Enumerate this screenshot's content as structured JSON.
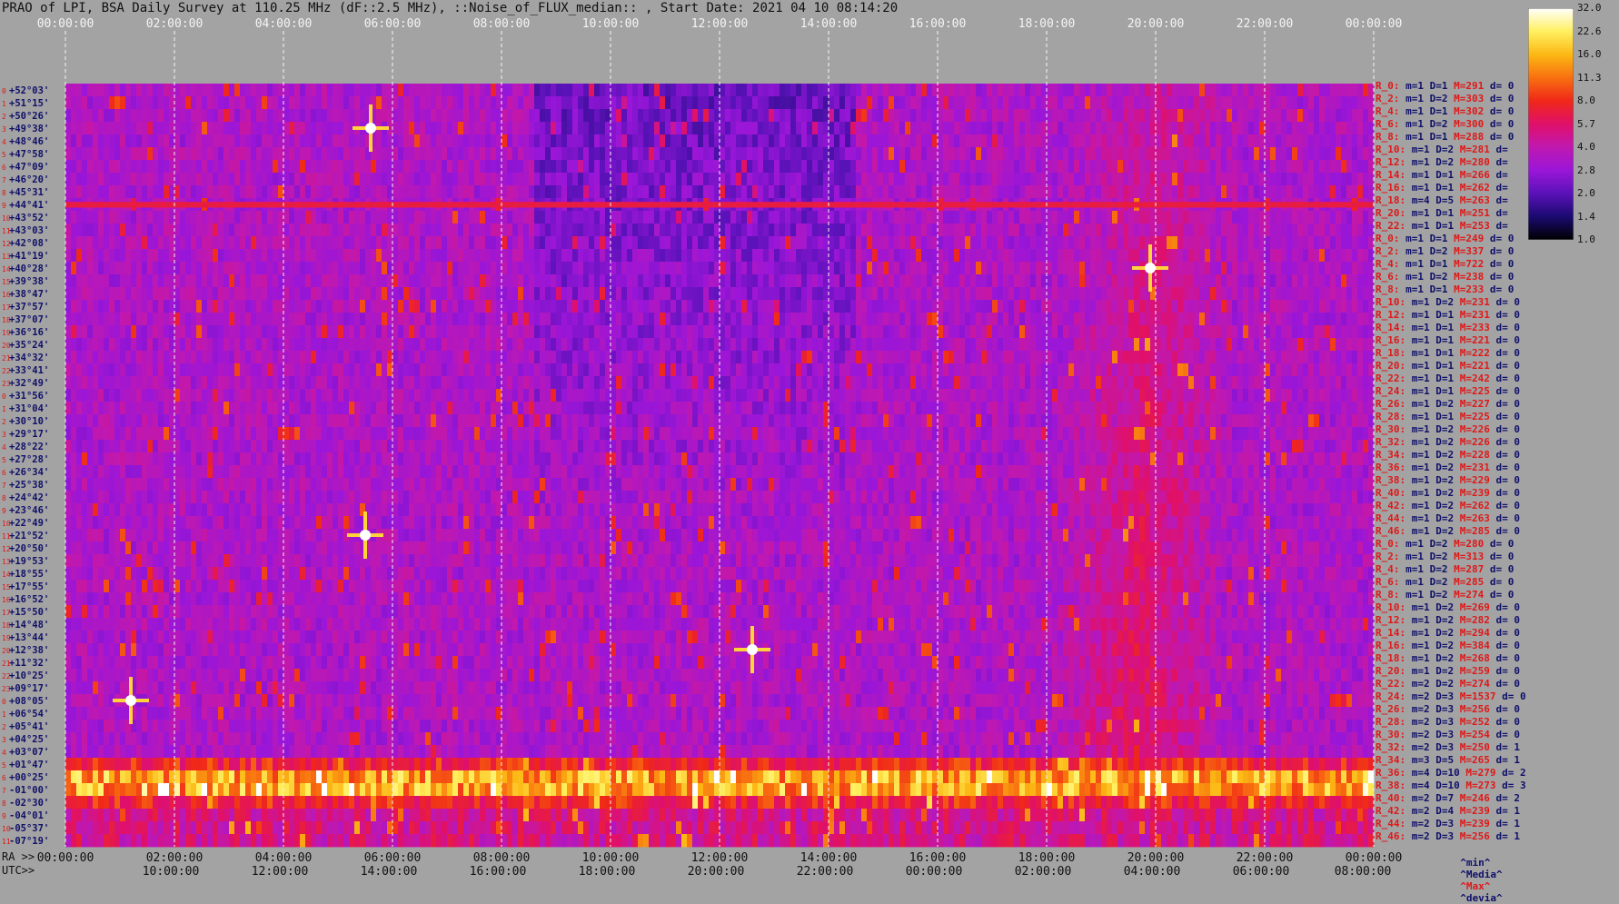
{
  "title": "PRAO of LPI, BSA Daily Survey at 110.25 MHz (dF::2.5 MHz), ::Noise_of_FLUX_median:: , Start Date: 2021 04 10 08:14:20",
  "chart_data": {
    "type": "heatmap",
    "title": "PRAO of LPI, BSA Daily Survey at 110.25 MHz (dF::2.5 MHz), ::Noise_of_FLUX_median:: , Start Date: 2021 04 10 08:14:20",
    "top_axis_ticks": [
      "00:00:00",
      "02:00:00",
      "04:00:00",
      "06:00:00",
      "08:00:00",
      "10:00:00",
      "12:00:00",
      "14:00:00",
      "16:00:00",
      "18:00:00",
      "20:00:00",
      "22:00:00",
      "00:00:00"
    ],
    "ra_axis_label": "RA >>",
    "ra_axis_ticks": [
      "00:00:00",
      "02:00:00",
      "04:00:00",
      "06:00:00",
      "08:00:00",
      "10:00:00",
      "12:00:00",
      "14:00:00",
      "16:00:00",
      "18:00:00",
      "20:00:00",
      "22:00:00",
      "00:00:00"
    ],
    "utc_axis_label": "UTC>>",
    "utc_axis_ticks": [
      "10:00:00",
      "12:00:00",
      "14:00:00",
      "16:00:00",
      "18:00:00",
      "20:00:00",
      "22:00:00",
      "00:00:00",
      "02:00:00",
      "04:00:00",
      "06:00:00",
      "08:00:00"
    ],
    "dec_axis_ticks": [
      "+52°03'",
      "+51°15'",
      "+50°26'",
      "+49°38'",
      "+48°46'",
      "+47°58'",
      "+47°09'",
      "+46°20'",
      "+45°31'",
      "+44°41'",
      "+43°52'",
      "+43°03'",
      "+42°08'",
      "+41°19'",
      "+40°28'",
      "+39°38'",
      "+38°47'",
      "+37°57'",
      "+37°07'",
      "+36°16'",
      "+35°24'",
      "+34°32'",
      "+33°41'",
      "+32°49'",
      "+31°56'",
      "+31°04'",
      "+30°10'",
      "+29°17'",
      "+28°22'",
      "+27°28'",
      "+26°34'",
      "+25°38'",
      "+24°42'",
      "+23°46'",
      "+22°49'",
      "+21°52'",
      "+20°50'",
      "+19°53'",
      "+18°55'",
      "+17°55'",
      "+16°52'",
      "+15°50'",
      "+14°48'",
      "+13°44'",
      "+12°38'",
      "+11°32'",
      "+10°25'",
      "+09°17'",
      "+08°05'",
      "+06°54'",
      "+05°41'",
      "+04°25'",
      "+03°07'",
      "+01°47'",
      "+00°25'",
      "-01°00'",
      "-02°30'",
      "-04°01'",
      "-05°37'",
      "-07°19'"
    ],
    "colorbar": {
      "ticks": [
        "32.0",
        "22.6",
        "16.0",
        "11.3",
        "8.0",
        "5.7",
        "4.0",
        "2.8",
        "2.0",
        "1.4",
        "1.0"
      ],
      "range": [
        1.0,
        32.0
      ],
      "scale": "log"
    },
    "colormap": [
      "#000000",
      "#1a0a70",
      "#5a12b8",
      "#9a16d8",
      "#c018b0",
      "#e0106a",
      "#f02818",
      "#f87010",
      "#fcb814",
      "#fff060",
      "#ffffff"
    ],
    "features": {
      "horizontal_band_dec": "+44°41'",
      "bright_band_dec": [
        "+00°25'",
        "-01°00'"
      ],
      "bright_sources": [
        {
          "ra_hours": 1.2,
          "dec": "+08°05'"
        },
        {
          "ra_hours": 5.6,
          "dec": "+49°38'"
        },
        {
          "ra_hours": 5.5,
          "dec": "+21°52'"
        },
        {
          "ra_hours": 12.6,
          "dec": "+12°38'"
        },
        {
          "ra_hours": 19.9,
          "dec": "+40°28'"
        }
      ],
      "galactic_plane_ra_hours": [
        18.8,
        20.6
      ]
    }
  },
  "right_panel": [
    {
      "r": "R_0:",
      "m": "m=1 D=1",
      "M": "M=291",
      "d": "d= 0"
    },
    {
      "r": "R_2:",
      "m": "m=1 D=2",
      "M": "M=303",
      "d": "d= 0"
    },
    {
      "r": "R_4:",
      "m": "m=1 D=1",
      "M": "M=302",
      "d": "d= 0"
    },
    {
      "r": "R_6:",
      "m": "m=1 D=2",
      "M": "M=300",
      "d": "d= 0"
    },
    {
      "r": "R_8:",
      "m": "m=1 D=1",
      "M": "M=288",
      "d": "d= 0"
    },
    {
      "r": "R_10:",
      "m": "m=1 D=2",
      "M": "M=281",
      "d": "d="
    },
    {
      "r": "R_12:",
      "m": "m=1 D=2",
      "M": "M=280",
      "d": "d="
    },
    {
      "r": "R_14:",
      "m": "m=1 D=1",
      "M": "M=266",
      "d": "d="
    },
    {
      "r": "R_16:",
      "m": "m=1 D=1",
      "M": "M=262",
      "d": "d="
    },
    {
      "r": "R_18:",
      "m": "m=4 D=5",
      "M": "M=263",
      "d": "d="
    },
    {
      "r": "R_20:",
      "m": "m=1 D=1",
      "M": "M=251",
      "d": "d="
    },
    {
      "r": "R_22:",
      "m": "m=1 D=1",
      "M": "M=253",
      "d": "d="
    },
    {
      "r": "R_0:",
      "m": "m=1 D=1",
      "M": "M=249",
      "d": "d= 0"
    },
    {
      "r": "R_2:",
      "m": "m=1 D=2",
      "M": "M=337",
      "d": "d= 0"
    },
    {
      "r": "R_4:",
      "m": "m=1 D=1",
      "M": "M=722",
      "d": "d= 0"
    },
    {
      "r": "R_6:",
      "m": "m=1 D=2",
      "M": "M=238",
      "d": "d= 0"
    },
    {
      "r": "R_8:",
      "m": "m=1 D=1",
      "M": "M=233",
      "d": "d= 0"
    },
    {
      "r": "R_10:",
      "m": "m=1 D=2",
      "M": "M=231",
      "d": "d= 0"
    },
    {
      "r": "R_12:",
      "m": "m=1 D=1",
      "M": "M=231",
      "d": "d= 0"
    },
    {
      "r": "R_14:",
      "m": "m=1 D=1",
      "M": "M=233",
      "d": "d= 0"
    },
    {
      "r": "R_16:",
      "m": "m=1 D=1",
      "M": "M=221",
      "d": "d= 0"
    },
    {
      "r": "R_18:",
      "m": "m=1 D=1",
      "M": "M=222",
      "d": "d= 0"
    },
    {
      "r": "R_20:",
      "m": "m=1 D=1",
      "M": "M=221",
      "d": "d= 0"
    },
    {
      "r": "R_22:",
      "m": "m=1 D=1",
      "M": "M=242",
      "d": "d= 0"
    },
    {
      "r": "R_24:",
      "m": "m=1 D=1",
      "M": "M=225",
      "d": "d= 0"
    },
    {
      "r": "R_26:",
      "m": "m=1 D=2",
      "M": "M=227",
      "d": "d= 0"
    },
    {
      "r": "R_28:",
      "m": "m=1 D=1",
      "M": "M=225",
      "d": "d= 0"
    },
    {
      "r": "R_30:",
      "m": "m=1 D=2",
      "M": "M=226",
      "d": "d= 0"
    },
    {
      "r": "R_32:",
      "m": "m=1 D=2",
      "M": "M=226",
      "d": "d= 0"
    },
    {
      "r": "R_34:",
      "m": "m=1 D=2",
      "M": "M=228",
      "d": "d= 0"
    },
    {
      "r": "R_36:",
      "m": "m=1 D=2",
      "M": "M=231",
      "d": "d= 0"
    },
    {
      "r": "R_38:",
      "m": "m=1 D=2",
      "M": "M=229",
      "d": "d= 0"
    },
    {
      "r": "R_40:",
      "m": "m=1 D=2",
      "M": "M=239",
      "d": "d= 0"
    },
    {
      "r": "R_42:",
      "m": "m=1 D=2",
      "M": "M=262",
      "d": "d= 0"
    },
    {
      "r": "R_44:",
      "m": "m=1 D=2",
      "M": "M=263",
      "d": "d= 0"
    },
    {
      "r": "R_46:",
      "m": "m=1 D=2",
      "M": "M=285",
      "d": "d= 0"
    },
    {
      "r": "R_0:",
      "m": "m=1 D=2",
      "M": "M=280",
      "d": "d= 0"
    },
    {
      "r": "R_2:",
      "m": "m=1 D=2",
      "M": "M=313",
      "d": "d= 0"
    },
    {
      "r": "R_4:",
      "m": "m=1 D=2",
      "M": "M=287",
      "d": "d= 0"
    },
    {
      "r": "R_6:",
      "m": "m=1 D=2",
      "M": "M=285",
      "d": "d= 0"
    },
    {
      "r": "R_8:",
      "m": "m=1 D=2",
      "M": "M=274",
      "d": "d= 0"
    },
    {
      "r": "R_10:",
      "m": "m=1 D=2",
      "M": "M=269",
      "d": "d= 0"
    },
    {
      "r": "R_12:",
      "m": "m=1 D=2",
      "M": "M=282",
      "d": "d= 0"
    },
    {
      "r": "R_14:",
      "m": "m=1 D=2",
      "M": "M=294",
      "d": "d= 0"
    },
    {
      "r": "R_16:",
      "m": "m=1 D=2",
      "M": "M=384",
      "d": "d= 0"
    },
    {
      "r": "R_18:",
      "m": "m=1 D=2",
      "M": "M=268",
      "d": "d= 0"
    },
    {
      "r": "R_20:",
      "m": "m=1 D=2",
      "M": "M=259",
      "d": "d= 0"
    },
    {
      "r": "R_22:",
      "m": "m=2 D=2",
      "M": "M=274",
      "d": "d= 0"
    },
    {
      "r": "R_24:",
      "m": "m=2 D=3",
      "M": "M=1537",
      "d": "d= 0"
    },
    {
      "r": "R_26:",
      "m": "m=2 D=3",
      "M": "M=256",
      "d": "d= 0"
    },
    {
      "r": "R_28:",
      "m": "m=2 D=3",
      "M": "M=252",
      "d": "d= 0"
    },
    {
      "r": "R_30:",
      "m": "m=2 D=3",
      "M": "M=254",
      "d": "d= 0"
    },
    {
      "r": "R_32:",
      "m": "m=2 D=3",
      "M": "M=250",
      "d": "d= 1"
    },
    {
      "r": "R_34:",
      "m": "m=3 D=5",
      "M": "M=265",
      "d": "d= 1"
    },
    {
      "r": "R_36:",
      "m": "m=4 D=10",
      "M": "M=279",
      "d": "d= 2"
    },
    {
      "r": "R_38:",
      "m": "m=4 D=10",
      "M": "M=273",
      "d": "d= 3"
    },
    {
      "r": "R_40:",
      "m": "m=2 D=7",
      "M": "M=246",
      "d": "d= 2"
    },
    {
      "r": "R_42:",
      "m": "m=2 D=4",
      "M": "M=239",
      "d": "d= 1"
    },
    {
      "r": "R_44:",
      "m": "m=2 D=3",
      "M": "M=239",
      "d": "d= 1"
    },
    {
      "r": "R_46:",
      "m": "m=2 D=3",
      "M": "M=256",
      "d": "d= 1"
    }
  ],
  "legend": {
    "min": "^min^",
    "median": "^Media^",
    "max": "^Max^",
    "devia": "^devia^"
  },
  "colors": {
    "bg": "#a3a3a3",
    "red": "#e01818",
    "navy": "#10106a"
  }
}
